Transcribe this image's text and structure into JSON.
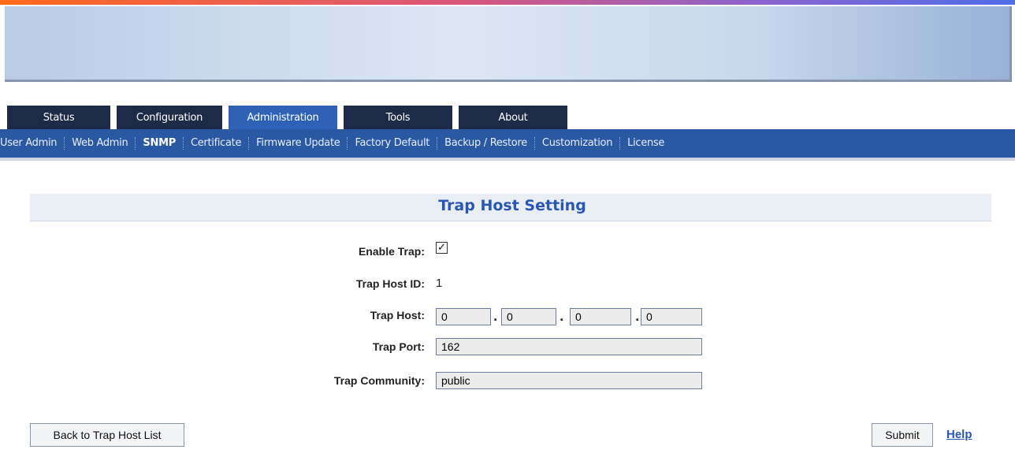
{
  "tabs": [
    {
      "label": "Status"
    },
    {
      "label": "Configuration"
    },
    {
      "label": "Administration"
    },
    {
      "label": "Tools"
    },
    {
      "label": "About"
    }
  ],
  "subnav": [
    {
      "label": "User Admin"
    },
    {
      "label": "Web Admin"
    },
    {
      "label": "SNMP"
    },
    {
      "label": "Certificate"
    },
    {
      "label": "Firmware Update"
    },
    {
      "label": "Factory Default"
    },
    {
      "label": "Backup / Restore"
    },
    {
      "label": "Customization"
    },
    {
      "label": "License"
    }
  ],
  "page_title": "Trap Host Setting",
  "form": {
    "enable_trap_label": "Enable Trap:",
    "enable_trap_checked": true,
    "trap_host_id_label": "Trap Host ID:",
    "trap_host_id_value": "1",
    "trap_host_label": "Trap Host:",
    "trap_host_octets": [
      "0",
      "0",
      "0",
      "0"
    ],
    "trap_port_label": "Trap Port:",
    "trap_port_value": "162",
    "trap_community_label": "Trap Community:",
    "trap_community_value": "public"
  },
  "buttons": {
    "back_label": "Back to Trap Host List",
    "submit_label": "Submit",
    "help_label": "Help"
  },
  "colors": {
    "accent": "#2a57b3",
    "tab_dark": "#1d2a48",
    "tab_active": "#2f62b7",
    "subnav_bg": "#2b58a2"
  }
}
